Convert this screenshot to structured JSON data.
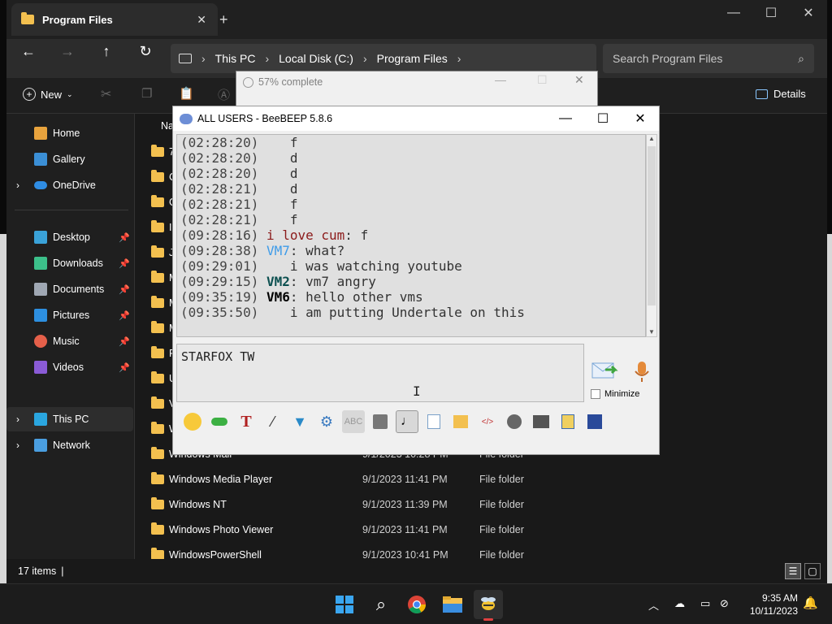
{
  "explorer": {
    "tab_title": "Program Files",
    "breadcrumb": [
      "This PC",
      "Local Disk (C:)",
      "Program Files"
    ],
    "search_placeholder": "Search Program Files",
    "new_label": "New",
    "details_label": "Details",
    "header_name": "Na",
    "sidebar": {
      "home": "Home",
      "gallery": "Gallery",
      "onedrive": "OneDrive",
      "desktop": "Desktop",
      "downloads": "Downloads",
      "documents": "Documents",
      "pictures": "Pictures",
      "music": "Music",
      "videos": "Videos",
      "thispc": "This PC",
      "network": "Network"
    },
    "files": [
      {
        "name": "Windows Mail",
        "date": "9/1/2023 10:28 PM",
        "type": "File folder"
      },
      {
        "name": "Windows Media Player",
        "date": "9/1/2023 11:41 PM",
        "type": "File folder"
      },
      {
        "name": "Windows NT",
        "date": "9/1/2023 11:39 PM",
        "type": "File folder"
      },
      {
        "name": "Windows Photo Viewer",
        "date": "9/1/2023 11:41 PM",
        "type": "File folder"
      },
      {
        "name": "WindowsPowerShell",
        "date": "9/1/2023 10:41 PM",
        "type": "File folder"
      }
    ],
    "partial_rows": [
      "7",
      "C",
      "G",
      "In",
      "Ja",
      "M",
      "M",
      "M",
      "R",
      "U",
      "V",
      "W"
    ],
    "item_count": "17 items"
  },
  "progress": {
    "title": "57% complete"
  },
  "beebeep": {
    "title": "ALL USERS - BeeBEEP 5.8.6",
    "messages": [
      {
        "time": "(02:28:20)",
        "user": "",
        "text": "   f"
      },
      {
        "time": "(02:28:20)",
        "user": "",
        "text": "   d"
      },
      {
        "time": "(02:28:20)",
        "user": "",
        "text": "   d"
      },
      {
        "time": "(02:28:21)",
        "user": "",
        "text": "   d"
      },
      {
        "time": "(02:28:21)",
        "user": "",
        "text": "   f"
      },
      {
        "time": "(02:28:21)",
        "user": "",
        "text": "   f"
      },
      {
        "time": "(09:28:16)",
        "user": "i love cum",
        "text": ": f"
      },
      {
        "time": "(09:28:38)",
        "user": "VM7",
        "text": ": what?"
      },
      {
        "time": "(09:29:01)",
        "user": "",
        "text": "   i was watching youtube"
      },
      {
        "time": "(09:29:15)",
        "user": "VM2",
        "text": ": vm7 angry"
      },
      {
        "time": "(09:35:19)",
        "user": "VM6",
        "text": ": hello other vms"
      },
      {
        "time": "(09:35:50)",
        "user": "",
        "text": "   i am putting Undertale on this"
      }
    ],
    "input_text": "STARFOX TW",
    "minimize_label": "Minimize",
    "user_colors": {
      "i love cum": "#8b1a1a",
      "VM7": "#3d9be9",
      "VM2": "#0b4f4f",
      "VM6": "#000000"
    }
  },
  "taskbar": {
    "time": "9:35 AM",
    "date": "10/11/2023"
  }
}
